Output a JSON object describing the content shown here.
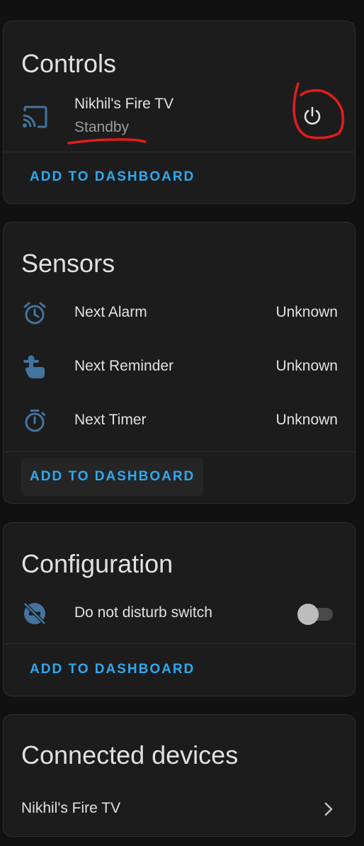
{
  "colors": {
    "background": "#111111",
    "card": "#1c1c1c",
    "accent": "#2da9f0",
    "icon": "#44739e",
    "annotation": "#e11d1d"
  },
  "controls": {
    "title": "Controls",
    "device_name": "Nikhil's Fire TV",
    "device_state": "Standby",
    "device_icon": "cast-icon",
    "power_icon": "power-icon",
    "add_label": "ADD TO DASHBOARD"
  },
  "sensors": {
    "title": "Sensors",
    "items": [
      {
        "label": "Next Alarm",
        "value": "Unknown",
        "icon": "alarm-clock-icon"
      },
      {
        "label": "Next Reminder",
        "value": "Unknown",
        "icon": "reminder-hand-icon"
      },
      {
        "label": "Next Timer",
        "value": "Unknown",
        "icon": "timer-icon"
      }
    ],
    "add_label": "ADD TO DASHBOARD"
  },
  "configuration": {
    "title": "Configuration",
    "item": {
      "label": "Do not disturb switch",
      "icon": "do-not-disturb-off-icon",
      "state": "off"
    },
    "add_label": "ADD TO DASHBOARD"
  },
  "connected_devices": {
    "title": "Connected devices",
    "items": [
      {
        "label": "Nikhil's Fire TV",
        "icon": "chevron-right-icon"
      }
    ]
  }
}
